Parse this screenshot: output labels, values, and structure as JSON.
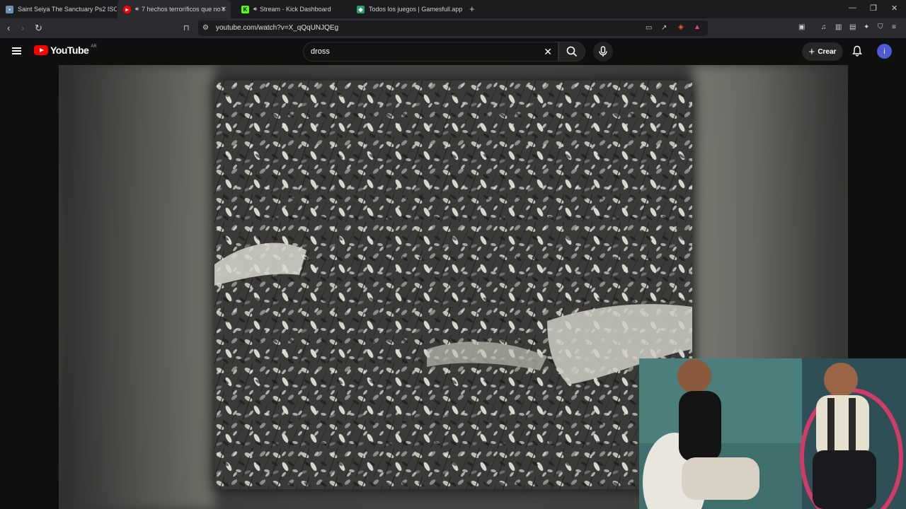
{
  "browser": {
    "tabs": [
      {
        "title": "Saint Seiya The Sanctuary Ps2 ISO (N",
        "active": false,
        "favicon": "image-favicon"
      },
      {
        "title": "7 hechos terroríficos que no t",
        "active": true,
        "favicon": "youtube-favicon",
        "audio": true
      },
      {
        "title": "Stream - Kick Dashboard",
        "active": false,
        "favicon": "kick-favicon",
        "audio": true
      },
      {
        "title": "Todos los juegos | Gamesfull.app",
        "active": false,
        "favicon": "gamepad-favicon"
      }
    ],
    "url": "youtube.com/watch?v=X_qQqUNJQEg"
  },
  "youtube": {
    "logo_text": "YouTube",
    "country_code": "AR",
    "search_value": "dross",
    "create_label": "Crear",
    "avatar_letter": "i"
  },
  "colors": {
    "youtube_red": "#ff0000",
    "avatar_bg": "#4f5bd5",
    "kick_green": "#53fc18"
  }
}
